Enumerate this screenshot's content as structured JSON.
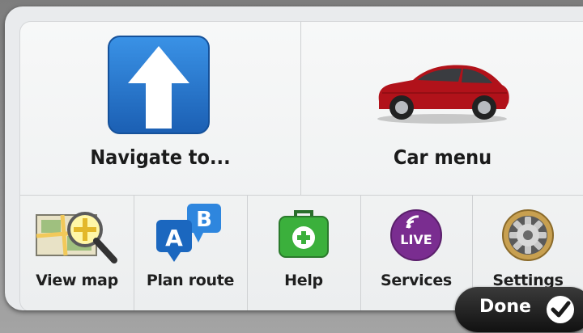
{
  "main_menu": {
    "navigate": {
      "label": "Navigate to...",
      "icon": "navigate-arrow-icon"
    },
    "car": {
      "label": "Car menu",
      "icon": "car-icon"
    }
  },
  "shortcuts": [
    {
      "label": "View map",
      "icon": "map-magnifier-icon"
    },
    {
      "label": "Plan route",
      "icon": "route-a-b-icon"
    },
    {
      "label": "Help",
      "icon": "first-aid-kit-icon"
    },
    {
      "label": "Services",
      "icon": "live-icon"
    },
    {
      "label": "Settings",
      "icon": "gear-icon"
    }
  ],
  "done": {
    "label": "Done",
    "icon": "check-icon"
  },
  "live_badge": "LIVE",
  "route_letters": {
    "a": "A",
    "b": "B"
  },
  "colors": {
    "accent_blue": "#1e6fc8",
    "car_red": "#b1121a",
    "help_green": "#3bb03c",
    "live_purple": "#7a2d90",
    "done_bg": "#1a1a1a"
  }
}
